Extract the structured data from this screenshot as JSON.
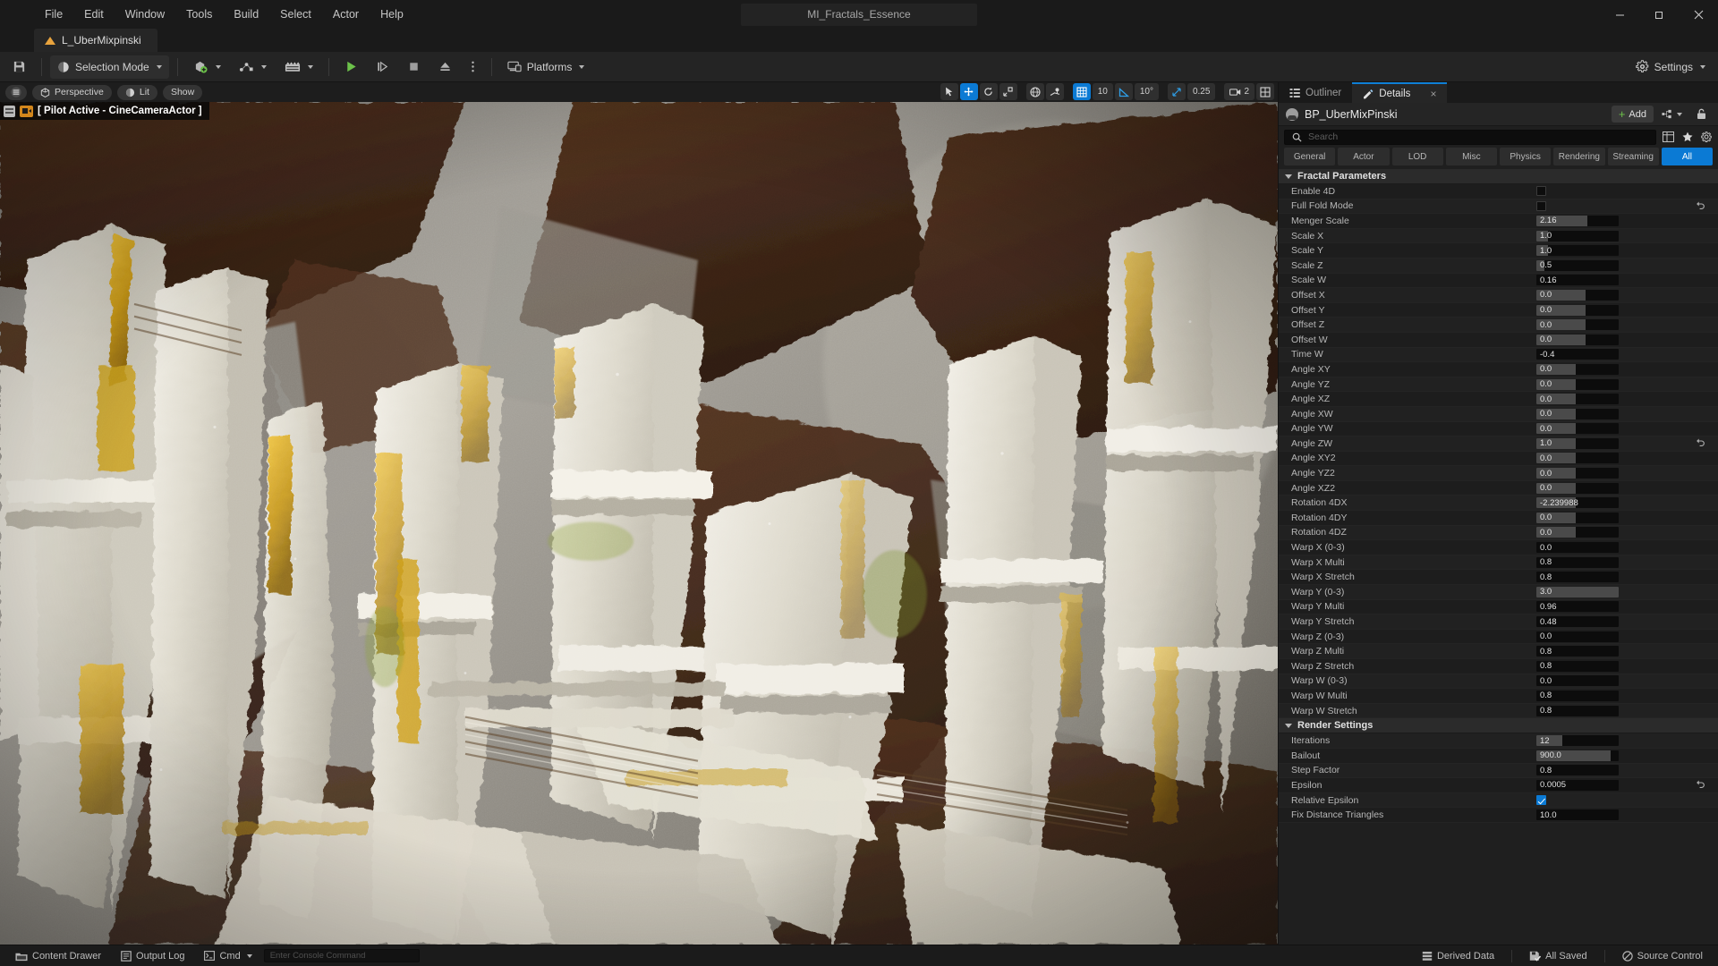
{
  "window": {
    "center_title": "MI_Fractals_Essence",
    "minimize": "—",
    "maximize": "❐",
    "close": "✕"
  },
  "menubar": {
    "items": [
      "File",
      "Edit",
      "Window",
      "Tools",
      "Build",
      "Select",
      "Actor",
      "Help"
    ]
  },
  "project_tab": {
    "label": "L_UberMixpinski"
  },
  "toolbar": {
    "save_icon": "save-icon",
    "selection_mode": "Selection Mode",
    "add_icon": "add-actor-icon",
    "blueprint_icon": "blueprints-icon",
    "cinematics_icon": "cinematics-icon",
    "play_icon": "play-icon",
    "skip_icon": "step-icon",
    "stop_icon": "stop-icon",
    "eject_icon": "eject-icon",
    "more_icon": "more-options-icon",
    "platforms": "Platforms",
    "settings": "Settings"
  },
  "viewport": {
    "menu_icon": "viewport-menu-icon",
    "camera_mode": "Perspective",
    "view_mode": "Lit",
    "show_menu": "Show",
    "pilot_label": "[ Pilot Active - CineCameraActor ]",
    "tools": [
      {
        "name": "select-tool",
        "glyph": "➤",
        "active": false
      },
      {
        "name": "move-tool",
        "glyph": "✥",
        "active": true
      },
      {
        "name": "rotate-tool",
        "glyph": "↻",
        "active": false
      },
      {
        "name": "scale-tool",
        "glyph": "⤢",
        "active": false
      }
    ],
    "coord_system_icon": "world-coordinate-icon",
    "surface_snap_icon": "surface-snap-icon",
    "grid_snap_icon": "grid-snap-icon",
    "grid_snap_value": "10",
    "angle_snap_icon": "angle-snap-icon",
    "angle_snap_value": "10°",
    "scale_snap_icon": "scale-snap-icon",
    "scale_snap_value": "0.25",
    "camera_speed_icon": "camera-speed-icon",
    "camera_speed_value": "2",
    "layout_icon": "viewport-layout-icon"
  },
  "details_panel": {
    "tabs": [
      {
        "label": "Outliner",
        "icon": "outliner-icon",
        "active": false
      },
      {
        "label": "Details",
        "icon": "details-pencil-icon",
        "active": true,
        "close": "×"
      }
    ],
    "object_name": "BP_UberMixPinski",
    "add_label": "Add",
    "search_placeholder": "Search",
    "filter_tabs": [
      "General",
      "Actor",
      "LOD",
      "Misc",
      "Physics",
      "Rendering",
      "Streaming",
      "All"
    ],
    "filter_active": "All",
    "sections": [
      {
        "title": "Fractal Parameters",
        "rows": [
          {
            "label": "Enable 4D",
            "type": "checkbox",
            "checked": false
          },
          {
            "label": "Full Fold Mode",
            "type": "checkbox",
            "checked": false,
            "revert": true
          },
          {
            "label": "Menger Scale",
            "type": "number",
            "value": "2.16",
            "fill": 62
          },
          {
            "label": "Scale X",
            "type": "number",
            "value": "1.0",
            "fill": 14
          },
          {
            "label": "Scale Y",
            "type": "number",
            "value": "1.0",
            "fill": 14
          },
          {
            "label": "Scale Z",
            "type": "number",
            "value": "0.5",
            "fill": 10
          },
          {
            "label": "Scale W",
            "type": "number",
            "value": "0.16",
            "fill": 0
          },
          {
            "label": "Offset X",
            "type": "number",
            "value": "0.0",
            "fill": 60
          },
          {
            "label": "Offset Y",
            "type": "number",
            "value": "0.0",
            "fill": 60
          },
          {
            "label": "Offset Z",
            "type": "number",
            "value": "0.0",
            "fill": 60
          },
          {
            "label": "Offset W",
            "type": "number",
            "value": "0.0",
            "fill": 60
          },
          {
            "label": "Time W",
            "type": "number",
            "value": "-0.4",
            "fill": 0
          },
          {
            "label": "Angle XY",
            "type": "number",
            "value": "0.0",
            "fill": 48
          },
          {
            "label": "Angle YZ",
            "type": "number",
            "value": "0.0",
            "fill": 48
          },
          {
            "label": "Angle XZ",
            "type": "number",
            "value": "0.0",
            "fill": 48
          },
          {
            "label": "Angle XW",
            "type": "number",
            "value": "0.0",
            "fill": 48
          },
          {
            "label": "Angle YW",
            "type": "number",
            "value": "0.0",
            "fill": 48
          },
          {
            "label": "Angle ZW",
            "type": "number",
            "value": "1.0",
            "fill": 48,
            "revert": true
          },
          {
            "label": "Angle XY2",
            "type": "number",
            "value": "0.0",
            "fill": 48
          },
          {
            "label": "Angle YZ2",
            "type": "number",
            "value": "0.0",
            "fill": 48
          },
          {
            "label": "Angle XZ2",
            "type": "number",
            "value": "0.0",
            "fill": 48
          },
          {
            "label": "Rotation 4DX",
            "type": "number",
            "value": "-2.239988",
            "fill": 48
          },
          {
            "label": "Rotation 4DY",
            "type": "number",
            "value": "0.0",
            "fill": 48
          },
          {
            "label": "Rotation 4DZ",
            "type": "number",
            "value": "0.0",
            "fill": 48
          },
          {
            "label": "Warp X (0-3)",
            "type": "number",
            "value": "0.0",
            "fill": 0
          },
          {
            "label": "Warp X Multi",
            "type": "number",
            "value": "0.8",
            "fill": 0
          },
          {
            "label": "Warp X Stretch",
            "type": "number",
            "value": "0.8",
            "fill": 0
          },
          {
            "label": "Warp Y (0-3)",
            "type": "number",
            "value": "3.0",
            "fill": 100
          },
          {
            "label": "Warp Y Multi",
            "type": "number",
            "value": "0.96",
            "fill": 0
          },
          {
            "label": "Warp Y Stretch",
            "type": "number",
            "value": "0.48",
            "fill": 0
          },
          {
            "label": "Warp Z (0-3)",
            "type": "number",
            "value": "0.0",
            "fill": 0
          },
          {
            "label": "Warp Z Multi",
            "type": "number",
            "value": "0.8",
            "fill": 0
          },
          {
            "label": "Warp Z Stretch",
            "type": "number",
            "value": "0.8",
            "fill": 0
          },
          {
            "label": "Warp W (0-3)",
            "type": "number",
            "value": "0.0",
            "fill": 0
          },
          {
            "label": "Warp W Multi",
            "type": "number",
            "value": "0.8",
            "fill": 0
          },
          {
            "label": "Warp W Stretch",
            "type": "number",
            "value": "0.8",
            "fill": 0
          }
        ]
      },
      {
        "title": "Render Settings",
        "rows": [
          {
            "label": "Iterations",
            "type": "number",
            "value": "12",
            "fill": 32
          },
          {
            "label": "Bailout",
            "type": "number",
            "value": "900.0",
            "fill": 90
          },
          {
            "label": "Step Factor",
            "type": "number",
            "value": "0.8",
            "fill": 0
          },
          {
            "label": "Epsilon",
            "type": "number",
            "value": "0.0005",
            "fill": 0,
            "revert": true
          },
          {
            "label": "Relative Epsilon",
            "type": "checkbox",
            "checked": true
          },
          {
            "label": "Fix Distance Triangles",
            "type": "number",
            "value": "10.0",
            "fill": 0
          }
        ]
      }
    ]
  },
  "statusbar": {
    "content_drawer": "Content Drawer",
    "output_log": "Output Log",
    "cmd": "Cmd",
    "console_placeholder": "Enter Console Command",
    "derived_data": "Derived Data",
    "all_saved": "All Saved",
    "source_control": "Source Control"
  },
  "colors": {
    "accent_blue": "#0b7ad4",
    "play_green": "#6cc24a",
    "tab_orange": "#e8a33d",
    "panel_bg": "#1f1f1f"
  }
}
